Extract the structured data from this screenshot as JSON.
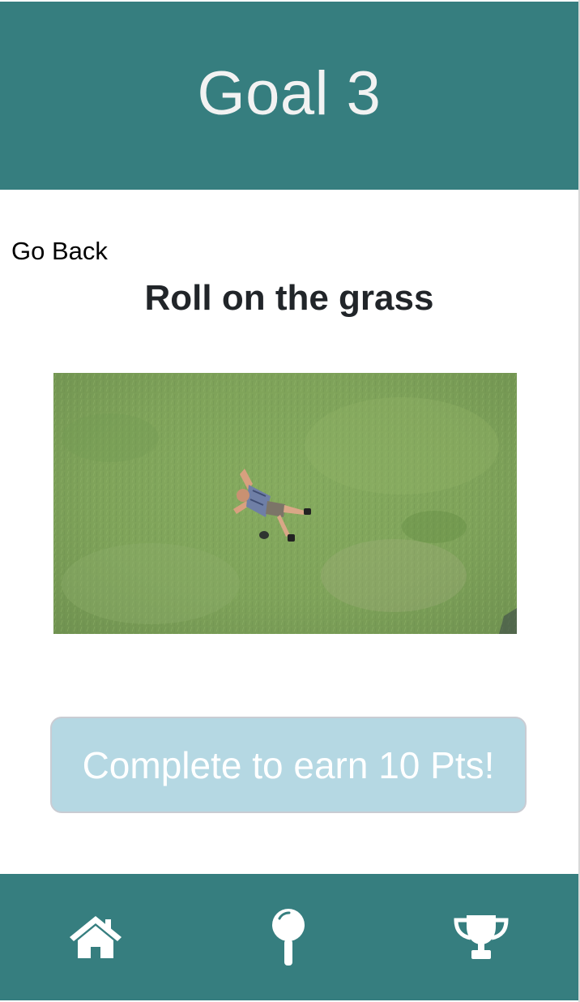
{
  "header": {
    "title": "Goal 3"
  },
  "nav": {
    "back_label": "Go Back"
  },
  "goal": {
    "name": "Roll on the grass",
    "image_description": "aerial-grass-person"
  },
  "action": {
    "complete_label": "Complete to earn 10 Pts!"
  },
  "footer": {
    "items": [
      {
        "icon": "home-icon"
      },
      {
        "icon": "magnifier-icon"
      },
      {
        "icon": "trophy-icon"
      }
    ]
  },
  "colors": {
    "brand_teal": "#367e7f",
    "button_light_blue": "#b5d8e3",
    "grass_green": "#7da35a",
    "header_text": "#f2f2f2",
    "body_text": "#212529"
  }
}
